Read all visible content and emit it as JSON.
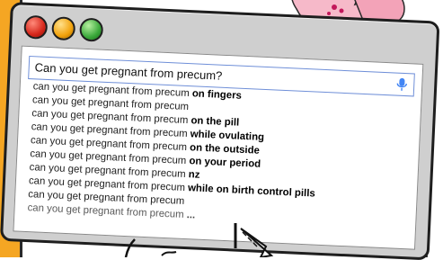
{
  "window": {
    "controls": [
      "close",
      "minimize",
      "maximize"
    ]
  },
  "search": {
    "query": "Can you get pregnant from precum?",
    "icon": "microphone-icon"
  },
  "suggestions": [
    {
      "prefix": "can you get pregnant from precum",
      "suffix": " on fingers"
    },
    {
      "prefix": "can you get pregnant from precum",
      "suffix": ""
    },
    {
      "prefix": "can you get pregnant from precum",
      "suffix": " on the pill"
    },
    {
      "prefix": "can you get pregnant from precum",
      "suffix": " while ovulating"
    },
    {
      "prefix": "can you get pregnant from precum",
      "suffix": " on the outside"
    },
    {
      "prefix": "can you get pregnant from precum",
      "suffix": " on your period"
    },
    {
      "prefix": "can you get pregnant from precum",
      "suffix": " nz"
    },
    {
      "prefix": "can you get pregnant from precum",
      "suffix": " while on birth control pills"
    },
    {
      "prefix": "can you get pregnant from precum",
      "suffix": ""
    },
    {
      "prefix": "can you get pregnant from precum",
      "suffix": " ..."
    }
  ],
  "colors": {
    "close": "#d6271b",
    "minimize": "#f2a20c",
    "maximize": "#3aa83a",
    "accent_strip": "#f5a623",
    "search_border": "#6f8fd8"
  }
}
